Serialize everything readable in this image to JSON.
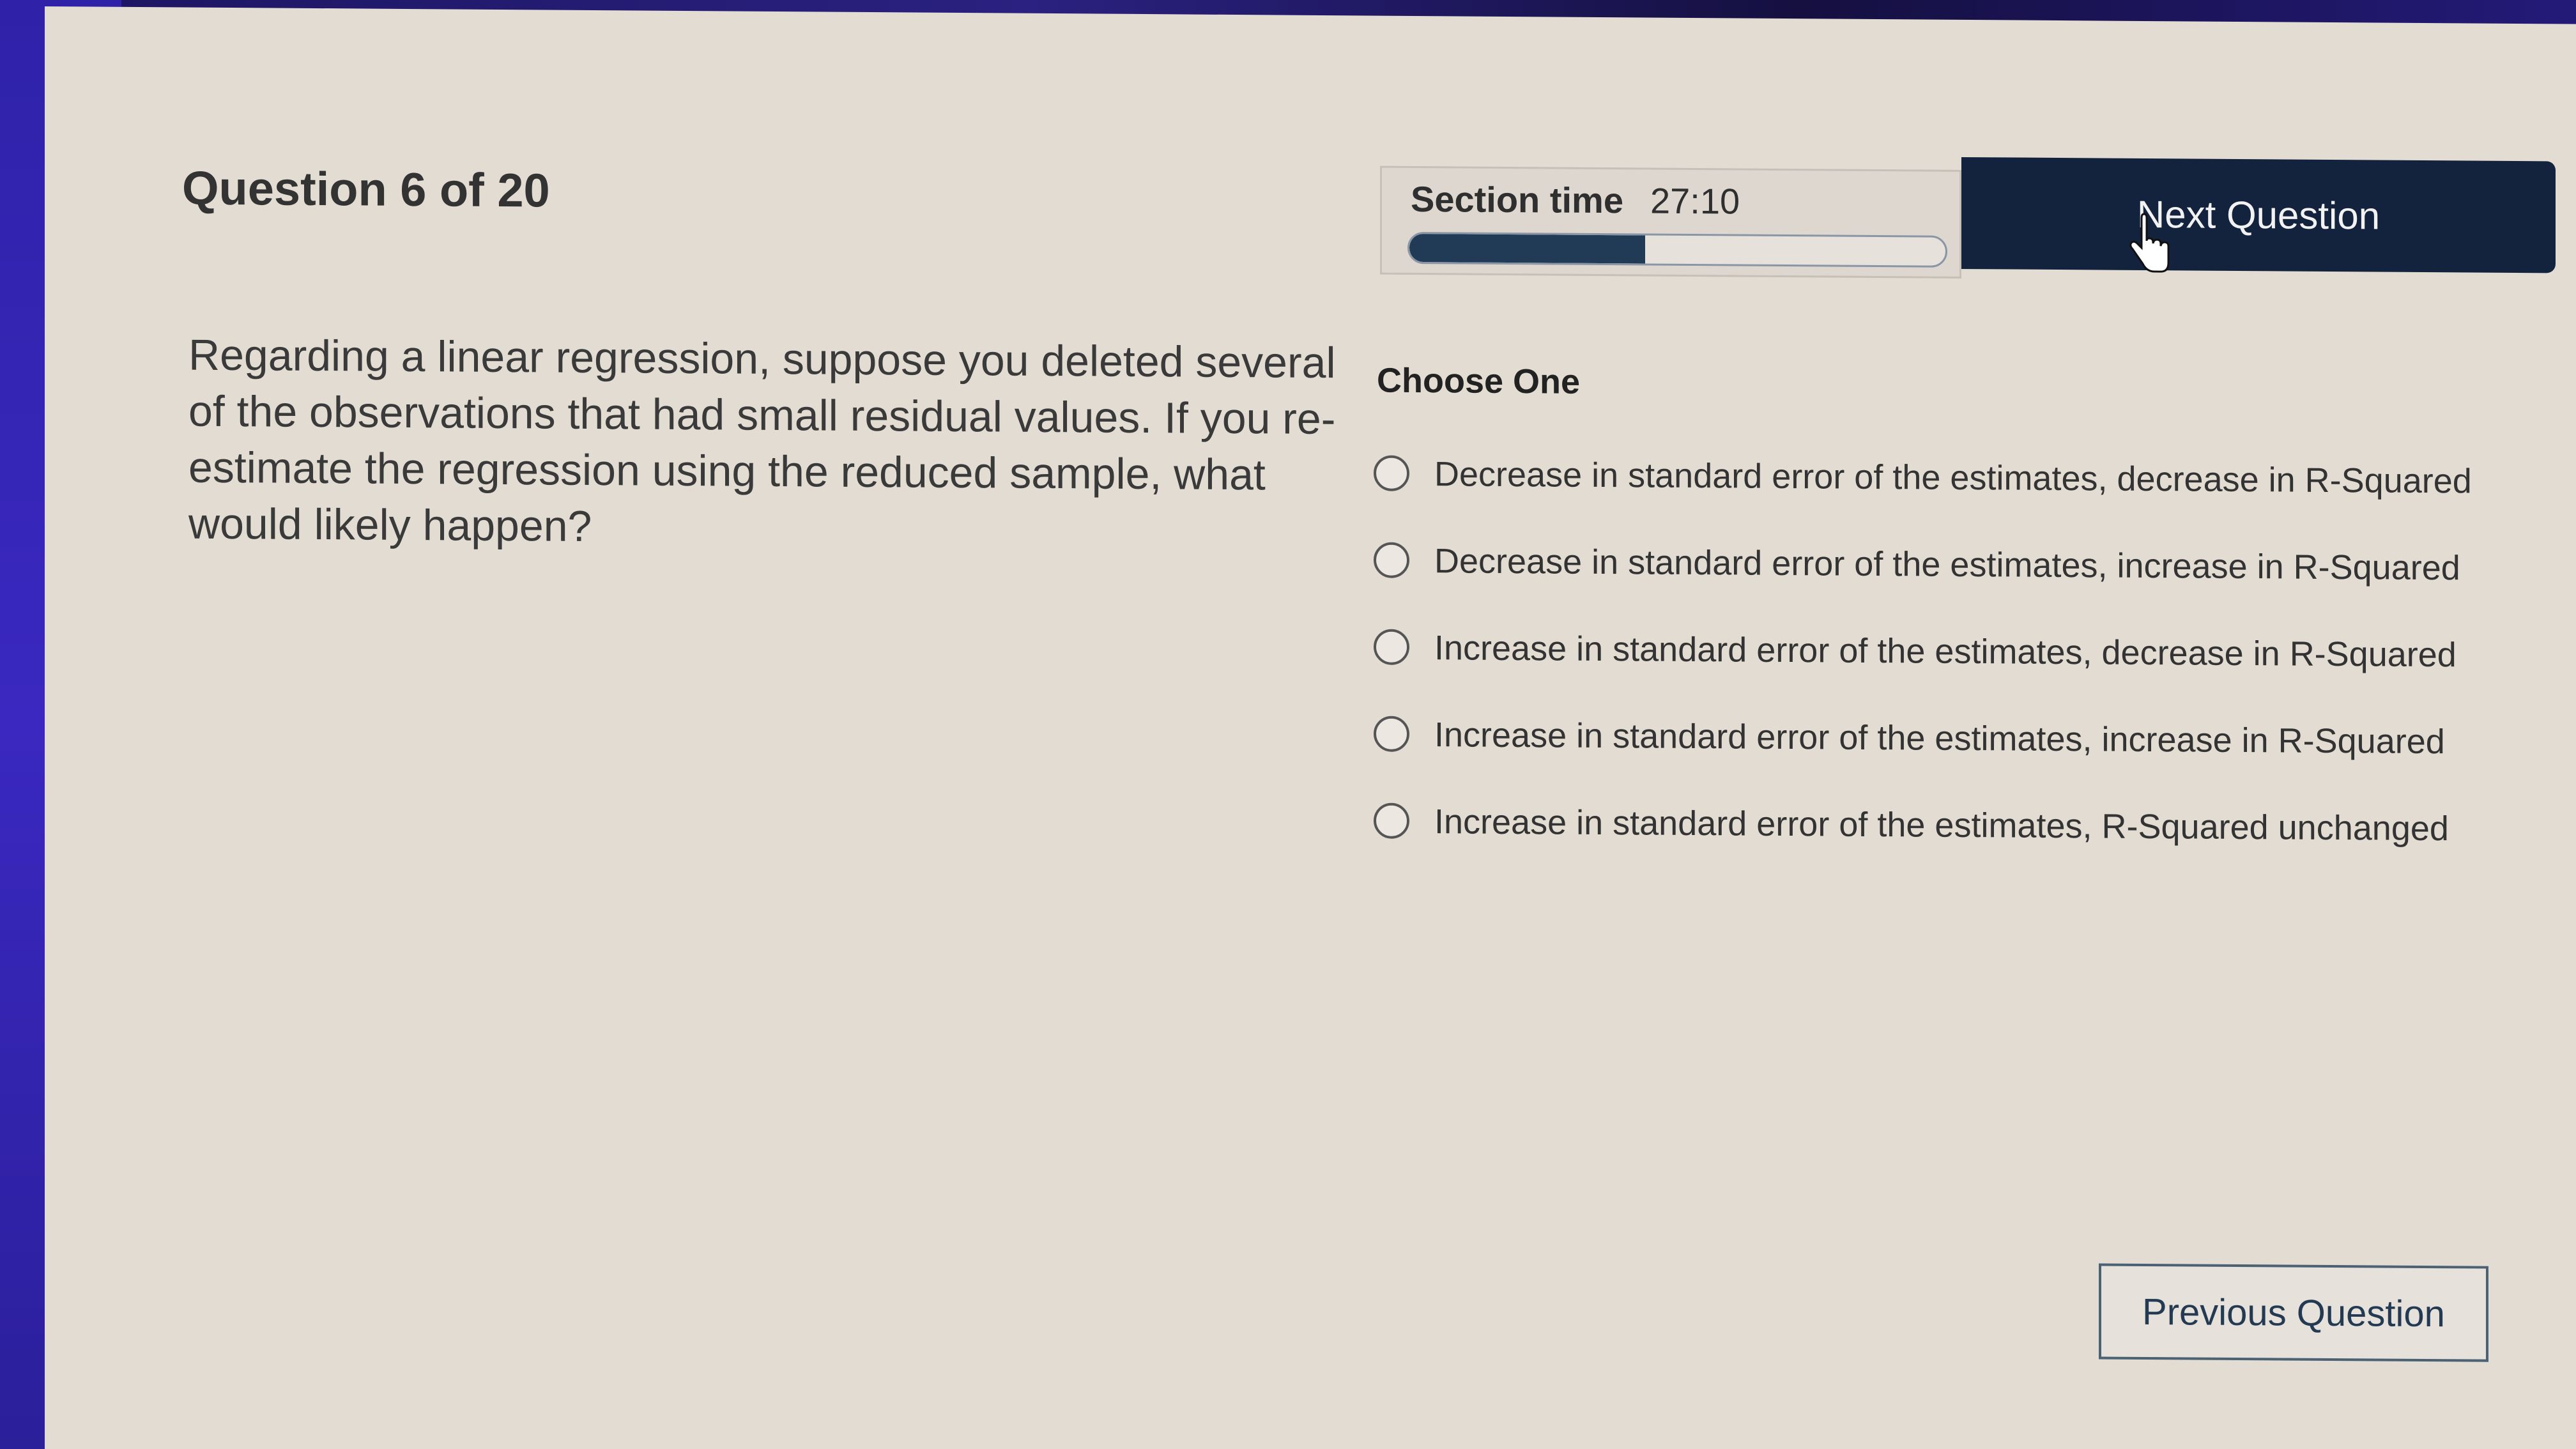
{
  "header": {
    "question_counter": "Question 6 of 20",
    "section_time_label": "Section time",
    "section_time_value": "27:10",
    "section_time_progress": 0.44,
    "next_button_label": "Next Question"
  },
  "question": {
    "text": "Regarding a linear regression, suppose you deleted several of the observations that had small residual values. If you re-estimate the regression using the reduced sample, what would likely happen?"
  },
  "answers": {
    "instruction": "Choose One",
    "options": [
      {
        "label": "Decrease in standard error of the estimates, decrease in R-Squared",
        "selected": false
      },
      {
        "label": "Decrease in standard error of the estimates, increase in R-Squared",
        "selected": false
      },
      {
        "label": "Increase in standard error of the estimates, decrease in R-Squared",
        "selected": false
      },
      {
        "label": "Increase in standard error of the estimates, increase in R-Squared",
        "selected": false
      },
      {
        "label": "Increase in standard error of the estimates, R-Squared unchanged",
        "selected": false
      }
    ]
  },
  "footer": {
    "previous_button_label": "Previous Question"
  },
  "icons": {
    "cursor": "hand-pointer-icon",
    "radio": "radio-unchecked-icon"
  },
  "colors": {
    "screen_background": "#e3dcd3",
    "next_button_background": "#13233d",
    "progress_fill": "#213a55",
    "previous_button_border": "#4b6174"
  }
}
